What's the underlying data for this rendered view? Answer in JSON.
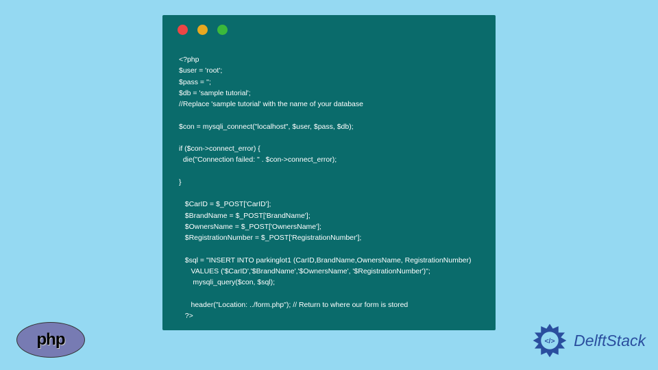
{
  "window": {
    "dots": [
      "red",
      "yellow",
      "green"
    ]
  },
  "code_lines": [
    "<?php",
    "$user = 'root';",
    "$pass = '';",
    "$db = 'sample tutorial';",
    "//Replace 'sample tutorial' with the name of your database",
    "",
    "$con = mysqli_connect(\"localhost\", $user, $pass, $db);",
    "",
    "if ($con->connect_error) {",
    "  die(\"Connection failed: \" . $con->connect_error);",
    "",
    "}",
    "",
    "   $CarID = $_POST['CarID'];",
    "   $BrandName = $_POST['BrandName'];",
    "   $OwnersName = $_POST['OwnersName'];",
    "   $RegistrationNumber = $_POST['RegistrationNumber'];",
    "",
    "   $sql = \"INSERT INTO parkinglot1 (CarID,BrandName,OwnersName, RegistrationNumber)",
    "      VALUES ('$CarID','$BrandName','$OwnersName', '$RegistrationNumber')\";",
    "       mysqli_query($con, $sql);",
    "",
    "      header(\"Location: ../form.php\"); // Return to where our form is stored",
    "   ?>"
  ],
  "php_badge": {
    "label": "php"
  },
  "delft": {
    "brand": "DelftStack"
  }
}
